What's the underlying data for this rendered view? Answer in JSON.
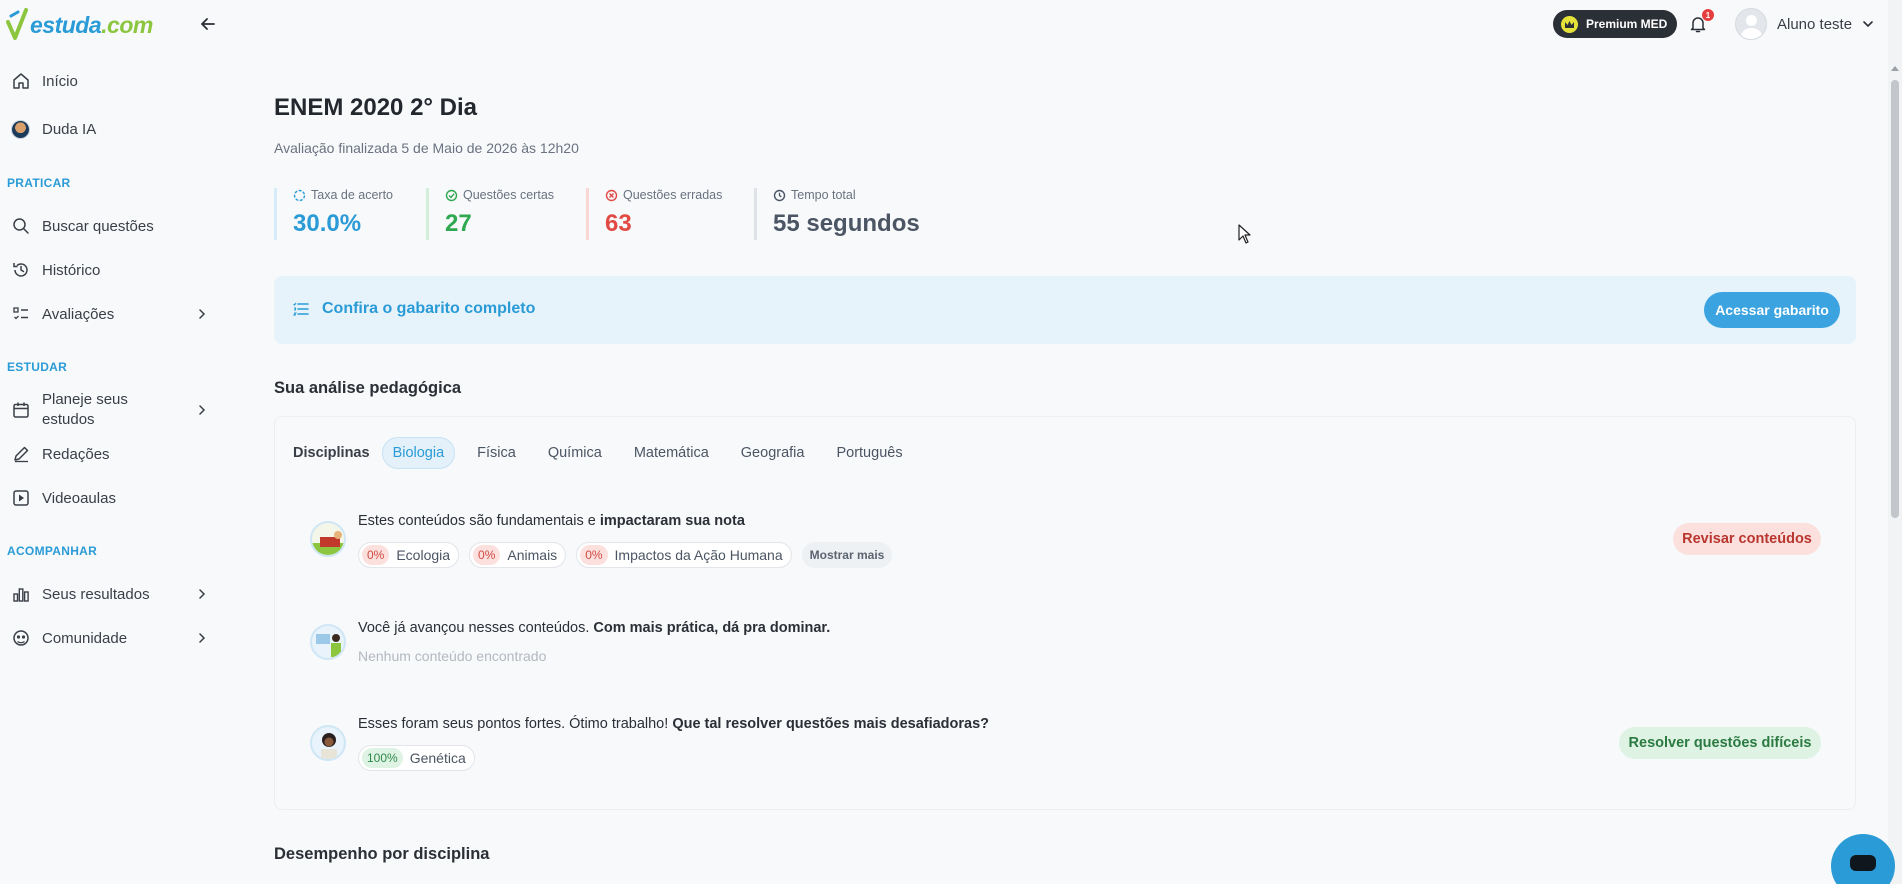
{
  "app": {
    "logo_text_a": "estuda",
    "logo_text_b": ".com",
    "brand_color": "#2a9bd6",
    "brand_accent": "#8cc63f"
  },
  "sidebar": {
    "items_top": [
      {
        "label": "Início",
        "icon": "home-icon"
      },
      {
        "label": "Duda IA",
        "icon": "duda-avatar"
      }
    ],
    "section_practice": "PRATICAR",
    "practice_items": [
      {
        "label": "Buscar questões",
        "icon": "search-icon"
      },
      {
        "label": "Histórico",
        "icon": "history-icon"
      },
      {
        "label": "Avaliações",
        "icon": "checklist-icon",
        "has_chevron": true
      }
    ],
    "section_study": "ESTUDAR",
    "study_items": [
      {
        "label": "Planeje seus estudos",
        "line1": "Planeje seus",
        "line2": "estudos",
        "icon": "calendar-icon",
        "has_chevron": true
      },
      {
        "label": "Redações",
        "icon": "pencil-icon"
      },
      {
        "label": "Videoaulas",
        "icon": "play-icon"
      }
    ],
    "section_follow": "ACOMPANHAR",
    "follow_items": [
      {
        "label": "Seus resultados",
        "icon": "bar-chart-icon",
        "has_chevron": true
      },
      {
        "label": "Comunidade",
        "icon": "community-icon",
        "has_chevron": true
      }
    ]
  },
  "topbar": {
    "premium_label": "Premium MED",
    "notification_count": "1",
    "user_name": "Aluno teste"
  },
  "main": {
    "title": "ENEM 2020 2° Dia",
    "subtitle": "Avaliação finalizada 5 de Maio de 2026 às 12h20",
    "stats": [
      {
        "label": "Taxa de acerto",
        "value": "30.0%",
        "icon": "progress-circle-icon",
        "color": "#2a9bd6"
      },
      {
        "label": "Questões certas",
        "value": "27",
        "icon": "check-circle-icon",
        "color": "#2fa84f"
      },
      {
        "label": "Questões erradas",
        "value": "63",
        "icon": "x-circle-icon",
        "color": "#e24a44"
      },
      {
        "label": "Tempo total",
        "value": "55 segundos",
        "icon": "clock-icon",
        "color": "#4b5563"
      }
    ],
    "gabarito": {
      "text": "Confira o gabarito completo",
      "button": "Acessar gabarito"
    },
    "analysis": {
      "heading": "Sua análise pedagógica",
      "tabs_label": "Disciplinas",
      "tabs": [
        "Biologia",
        "Física",
        "Química",
        "Matemática",
        "Geografia",
        "Português"
      ],
      "active_tab": "Biologia",
      "rows": [
        {
          "text_plain": "Estes conteúdos são fundamentais e ",
          "text_bold": "impactaram sua nota",
          "chips": [
            {
              "pct": "0%",
              "label": "Ecologia"
            },
            {
              "pct": "0%",
              "label": "Animais"
            },
            {
              "pct": "0%",
              "label": "Impactos da Ação Humana"
            }
          ],
          "more_label": "Mostrar mais",
          "action": "Revisar conteúdos"
        },
        {
          "text_plain": "Você já avançou nesses conteúdos. ",
          "text_bold": "Com mais prática, dá pra dominar.",
          "empty": "Nenhum conteúdo encontrado"
        },
        {
          "text_plain": "Esses foram seus pontos fortes. Ótimo trabalho! ",
          "text_bold": "Que tal resolver questões mais desafiadoras?",
          "chips": [
            {
              "pct": "100%",
              "label": "Genética"
            }
          ],
          "action": "Resolver questões difíceis"
        }
      ]
    },
    "performance_heading": "Desempenho por disciplina"
  }
}
